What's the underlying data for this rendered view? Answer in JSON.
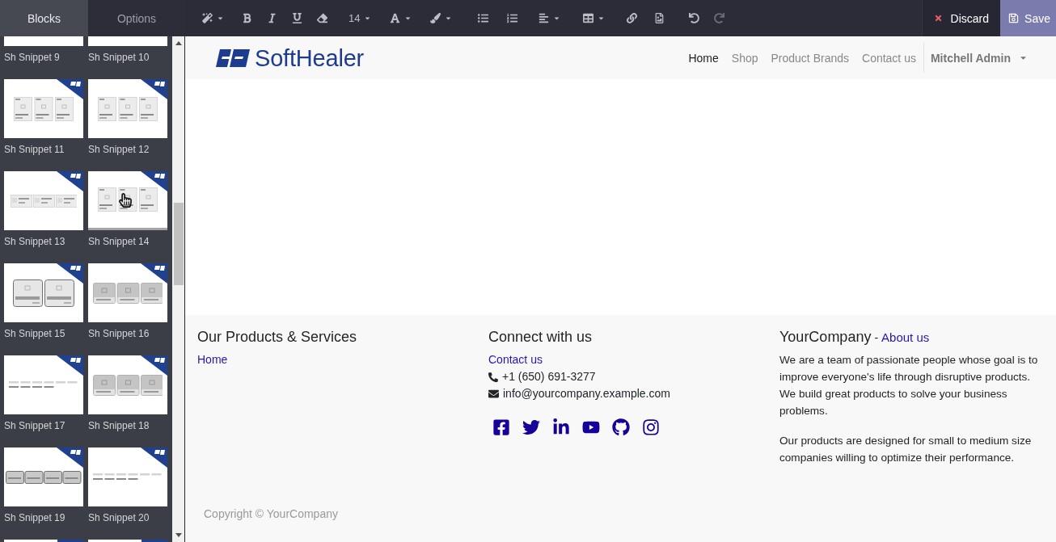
{
  "sidebar": {
    "tabs": [
      {
        "label": "Blocks",
        "selected": true
      },
      {
        "label": "Options",
        "selected": false
      }
    ],
    "snippets": [
      {
        "label": "Sh Snippet 9",
        "hovered": false
      },
      {
        "label": "Sh Snippet 10",
        "hovered": false
      },
      {
        "label": "Sh Snippet 11",
        "kind": "three-cards",
        "hovered": false
      },
      {
        "label": "Sh Snippet 12",
        "kind": "three-cards",
        "hovered": false
      },
      {
        "label": "Sh Snippet 13",
        "kind": "three-bars",
        "hovered": false
      },
      {
        "label": "Sh Snippet 14",
        "kind": "three-cards",
        "hovered": true
      },
      {
        "label": "Sh Snippet 15",
        "kind": "two-cards",
        "hovered": false
      },
      {
        "label": "Sh Snippet 16",
        "kind": "three-tiles",
        "hovered": false
      },
      {
        "label": "Sh Snippet 17",
        "kind": "text-lines",
        "hovered": false
      },
      {
        "label": "Sh Snippet 18",
        "kind": "three-tiles",
        "hovered": false
      },
      {
        "label": "Sh Snippet 19",
        "kind": "four-cards",
        "hovered": false
      },
      {
        "label": "Sh Snippet 20",
        "kind": "text-lines",
        "hovered": false
      }
    ]
  },
  "toolbar": {
    "font_size": "14",
    "history": [
      {
        "kind": "undo",
        "disabled": false
      },
      {
        "kind": "redo",
        "disabled": true
      }
    ],
    "actions": [
      {
        "kind": "discard",
        "label": "Discard"
      },
      {
        "kind": "save",
        "label": "Save"
      }
    ]
  },
  "navbar": {
    "brand": "SoftHealer",
    "menu": [
      {
        "label": "Home",
        "selected": true
      },
      {
        "label": "Shop",
        "selected": false
      },
      {
        "label": "Product Brands",
        "selected": false
      },
      {
        "label": "Contact us",
        "selected": false
      }
    ],
    "user": "Mitchell Admin"
  },
  "footer": {
    "products": {
      "title": "Our Products & Services",
      "links": [
        "Home"
      ]
    },
    "connect": {
      "title": "Connect with us",
      "link": "Contact us",
      "phone": "+1 (650) 691-3277",
      "email": "info@yourcompany.example.com"
    },
    "about": {
      "title": "YourCompany",
      "separator": "-",
      "link": "About us",
      "paragraphs": [
        "We are a team of passionate people whose goal is to improve everyone's life through disruptive products. We build great products to solve your business problems.",
        "Our products are designed for small to medium size companies willing to optimize their performance."
      ]
    },
    "copyright": "Copyright © YourCompany"
  }
}
